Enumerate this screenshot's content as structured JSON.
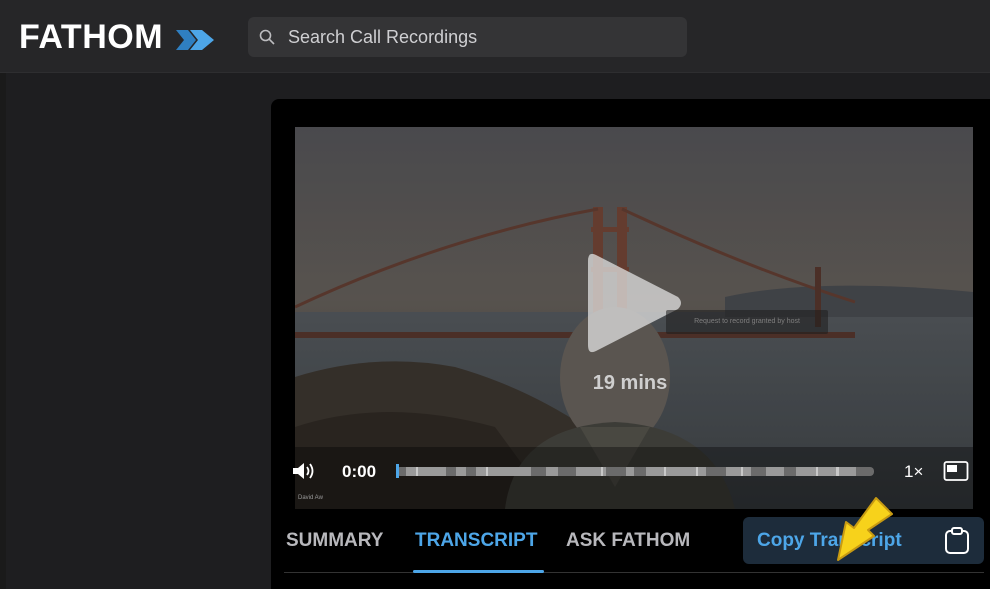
{
  "app": {
    "logo_text": "FATHOM",
    "accent": "#4da6e8"
  },
  "search": {
    "placeholder": "Search Call Recordings",
    "value": ""
  },
  "player": {
    "duration_label": "19 mins",
    "current_time": "0:00",
    "speed": "1×",
    "overlay_notice": "Request to record granted by host",
    "camera_label": "David Aw",
    "progress_fraction": 0.0
  },
  "tabs": [
    {
      "label": "SUMMARY",
      "active": false
    },
    {
      "label": "TRANSCRIPT",
      "active": true
    },
    {
      "label": "ASK FATHOM",
      "active": false
    }
  ],
  "copy_button": {
    "label": "Copy Transcript"
  },
  "icons": [
    "fathom-logo-icon",
    "search-icon",
    "play-icon",
    "volume-icon",
    "pip-icon",
    "clipboard-icon",
    "pointer-arrow-icon"
  ]
}
